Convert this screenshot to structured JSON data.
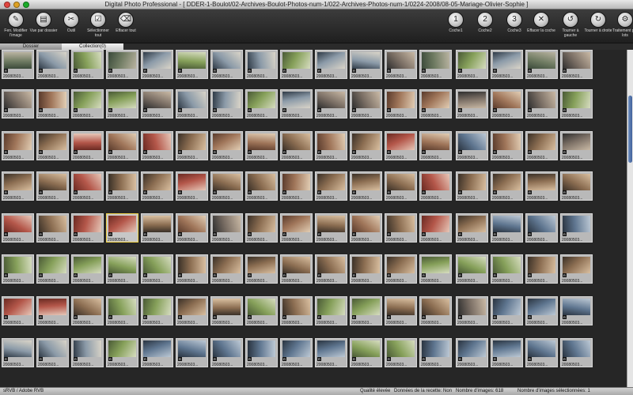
{
  "window": {
    "title": "Digital Photo Professional - [ DDER-1-Boulot/02-Archives-Boulot-Photos-num-1/022-Archives-Photos-num-1/0224-2008/08-05-Mariage-Olivier-Sophie ]"
  },
  "toolbar": {
    "left": [
      {
        "label": "Fen. Modifier l'image",
        "icon": "edit-image-icon"
      },
      {
        "label": "Vue par dossier",
        "icon": "folder-view-icon"
      },
      {
        "label": "Outil",
        "icon": "tool-icon"
      },
      {
        "label": "Sélectionner tout",
        "icon": "select-all-icon"
      },
      {
        "label": "Effacer tout",
        "icon": "clear-all-icon"
      }
    ],
    "right": [
      {
        "label": "Coche1",
        "icon": "check1-icon",
        "glyph": "1"
      },
      {
        "label": "Coche2",
        "icon": "check2-icon",
        "glyph": "2"
      },
      {
        "label": "Coche3",
        "icon": "check3-icon",
        "glyph": "3"
      },
      {
        "label": "Effacer la coche",
        "icon": "clear-check-icon",
        "glyph": "✕"
      },
      {
        "label": "Tourner à gauche",
        "icon": "rotate-left-icon",
        "glyph": "↺"
      },
      {
        "label": "Tourner à droite",
        "icon": "rotate-right-icon",
        "glyph": "↻"
      },
      {
        "label": "Traitement par lots",
        "icon": "batch-process-icon",
        "glyph": "⚙"
      }
    ]
  },
  "tabs": {
    "dossier": "Dossier",
    "collection": "Collection(0)"
  },
  "grid": {
    "thumb_label": "20080503...",
    "raw_badge": "R",
    "selected_index": 71
  },
  "status": {
    "color_space": "sRVB / Adobe RVB",
    "quality": "Qualité élevée",
    "recipe": "Données de la recette: Non",
    "image_count": "Nombre d'images: 618",
    "selected_count": "Nombre d'images sélectionnées: 1"
  }
}
